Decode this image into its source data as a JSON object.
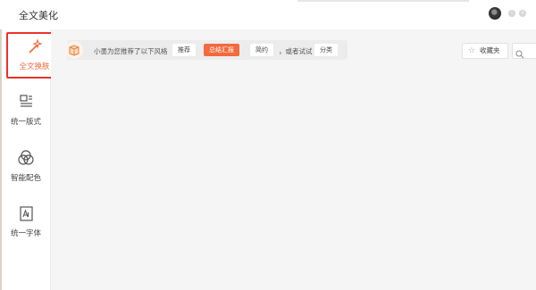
{
  "app": {
    "title": "全文美化"
  },
  "sidebar": {
    "items": [
      {
        "label": "全文换肤",
        "icon": "magic-wand-icon",
        "active": true
      },
      {
        "label": "统一版式",
        "icon": "layout-icon"
      },
      {
        "label": "智能配色",
        "icon": "color-circles-icon"
      },
      {
        "label": "统一字体",
        "icon": "font-icon"
      }
    ]
  },
  "recommend": {
    "prefix": "小墨为您推荐了以下风格",
    "chips": [
      "推荐",
      "总结汇报",
      "简约"
    ],
    "suffix": "，或者试试",
    "alt_chip": "分类"
  },
  "toolbar": {
    "favorites_label": "收藏夹",
    "search_placeholder": ""
  },
  "colors": {
    "accent": "#f26a3d",
    "active_border": "#e8332b"
  }
}
